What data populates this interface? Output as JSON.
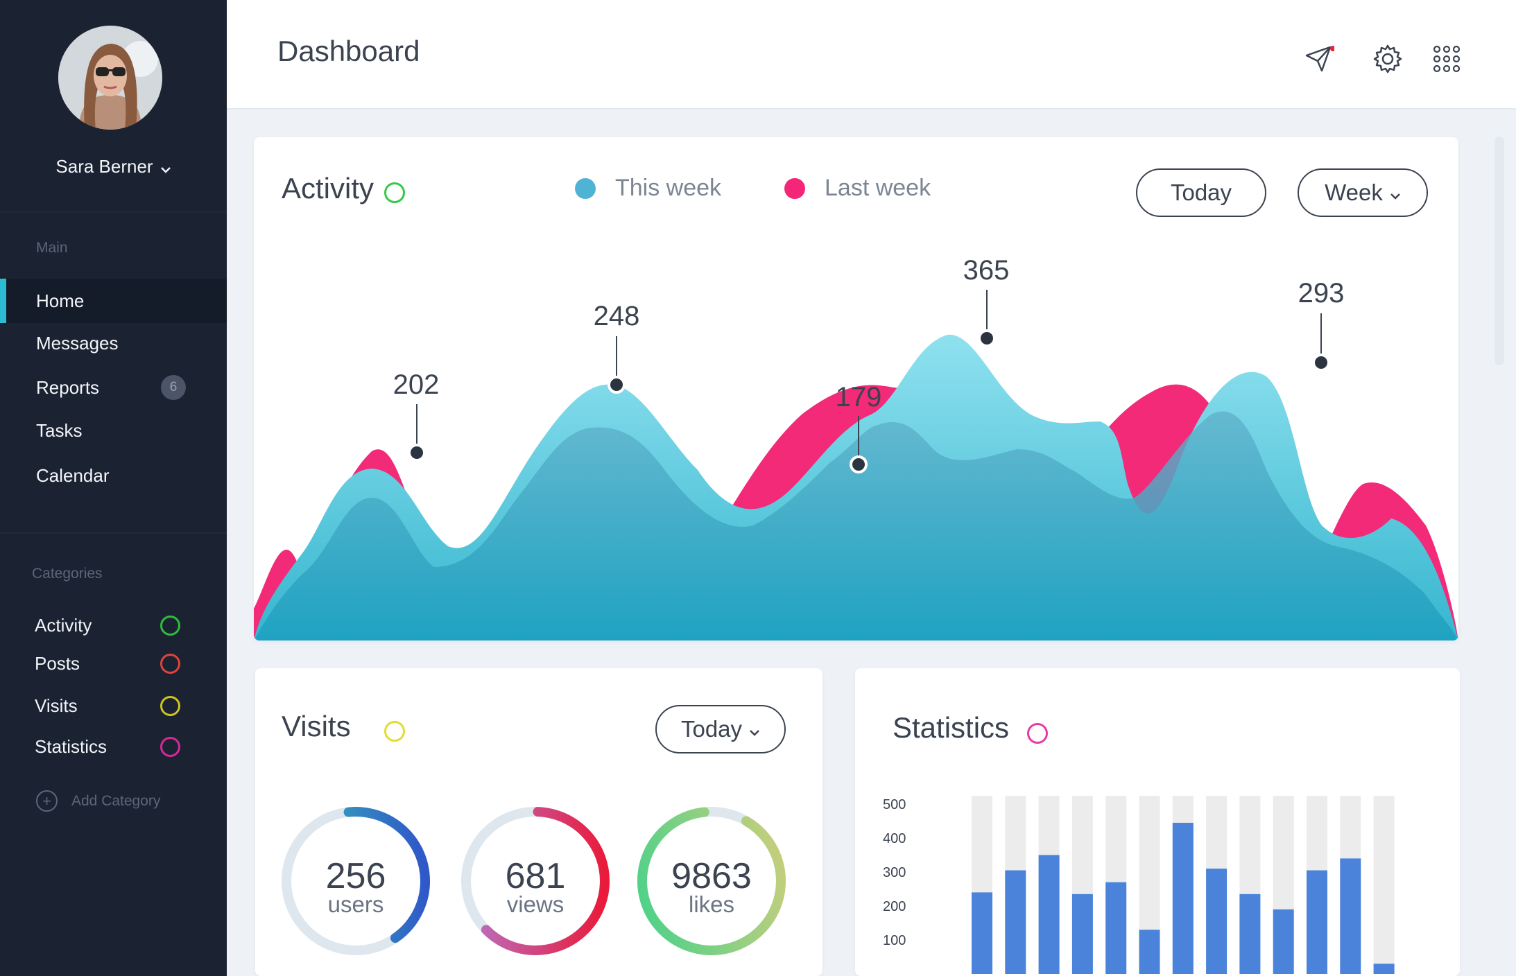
{
  "sidebar": {
    "user_name": "Sara Berner",
    "main_label": "Main",
    "nav": [
      {
        "label": "Home",
        "active": true
      },
      {
        "label": "Messages"
      },
      {
        "label": "Reports",
        "badge": "6"
      },
      {
        "label": "Tasks"
      },
      {
        "label": "Calendar"
      }
    ],
    "categories_label": "Categories",
    "categories": [
      {
        "label": "Activity",
        "color": "#2dbd3c"
      },
      {
        "label": "Posts",
        "color": "#e0433b"
      },
      {
        "label": "Visits",
        "color": "#cfc322"
      },
      {
        "label": "Statistics",
        "color": "#d6289a"
      }
    ],
    "add_category": "Add Category"
  },
  "header": {
    "title": "Dashboard",
    "icons": [
      "rocket-icon",
      "gear-icon",
      "apps-grid-icon"
    ]
  },
  "activity": {
    "title": "Activity",
    "title_ring_color": "#35c84a",
    "legend": [
      {
        "label": "This week",
        "color": "#4fb3d6"
      },
      {
        "label": "Last week",
        "color": "#f32677"
      }
    ],
    "today_button": "Today",
    "week_button": "Week",
    "peaks": [
      "202",
      "248",
      "179",
      "365",
      "293"
    ]
  },
  "visits": {
    "title": "Visits",
    "title_ring_color": "#e4dc2e",
    "today_button": "Today",
    "stats": [
      {
        "value": "256",
        "unit": "users",
        "fraction": 0.42
      },
      {
        "value": "681",
        "unit": "views",
        "fraction": 0.62
      },
      {
        "value": "9863",
        "unit": "likes",
        "fraction": 0.9
      }
    ]
  },
  "statistics": {
    "title": "Statistics",
    "title_ring_color": "#ea3aa6",
    "bar_color": "#4a83d9",
    "track_color": "#ececed"
  },
  "chart_data": {
    "type": "bar",
    "ylim": [
      0,
      500
    ],
    "ticks": [
      "500",
      "400",
      "300",
      "200",
      "100"
    ],
    "values": [
      240,
      305,
      350,
      235,
      270,
      130,
      445,
      310,
      235,
      190,
      305,
      340,
      30
    ]
  }
}
